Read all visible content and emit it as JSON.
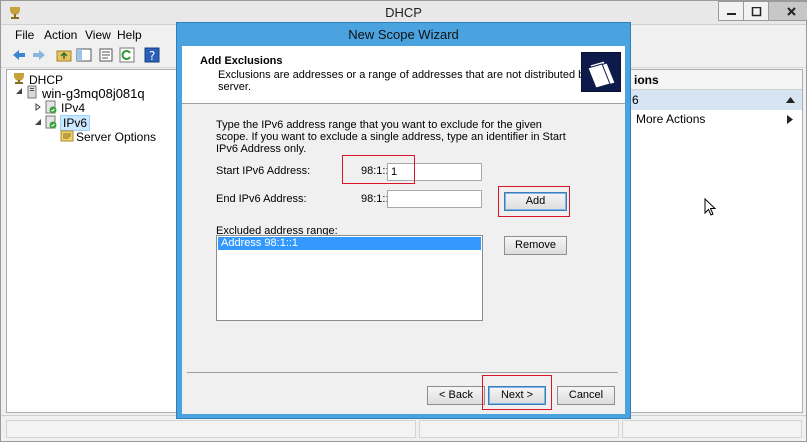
{
  "dhcp_window": {
    "title": "DHCP",
    "menu": [
      "File",
      "Action",
      "View",
      "Help"
    ],
    "tree": [
      {
        "label": "DHCP"
      },
      {
        "label": "win-g3mq08j081q"
      },
      {
        "label": "IPv4"
      },
      {
        "label": "IPv6"
      },
      {
        "label": "Server Options"
      }
    ],
    "actions": {
      "header": "ions",
      "section": "6",
      "item": "More Actions"
    }
  },
  "wizard": {
    "title": "New Scope Wizard",
    "header_title": "Add Exclusions",
    "header_subtitle": "Exclusions are addresses or a range of addresses that are not distributed by the server.",
    "instructions": "Type the IPv6 address range that you want to exclude for the given scope. If you want to exclude a single address, type an identifier in Start IPv6 Address only.",
    "start_label": "Start IPv6 Address:",
    "start_prefix": "98:1::",
    "start_value": "1",
    "end_label": "End IPv6 Address:",
    "end_prefix": "98:1::",
    "end_value": "",
    "excluded_label": "Excluded address range:",
    "excluded_items": [
      "Address 98:1::1"
    ],
    "add_button": "Add",
    "remove_button": "Remove",
    "back_button": "< Back",
    "next_button": "Next >",
    "cancel_button": "Cancel"
  }
}
